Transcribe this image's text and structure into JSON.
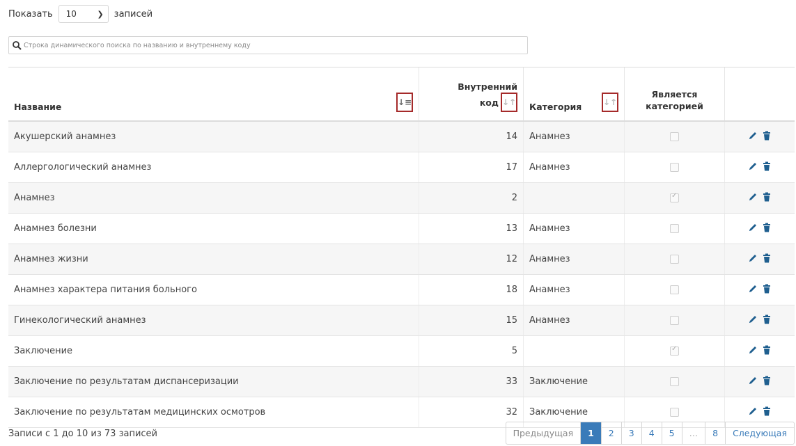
{
  "length_control": {
    "prefix": "Показать",
    "value": "10",
    "suffix": "записей"
  },
  "search": {
    "placeholder": "Строка динамического поиска по названию и внутреннему коду"
  },
  "columns": {
    "name": "Название",
    "code_line1": "Внутренний",
    "code_line2": "код",
    "category": "Категория",
    "is_category_line1": "Является",
    "is_category_line2": "категорией"
  },
  "rows": [
    {
      "name": "Акушерский анамнез",
      "code": "14",
      "category": "Анамнез",
      "is_category": false
    },
    {
      "name": "Аллергологический анамнез",
      "code": "17",
      "category": "Анамнез",
      "is_category": false
    },
    {
      "name": "Анамнез",
      "code": "2",
      "category": "",
      "is_category": true
    },
    {
      "name": "Анамнез болезни",
      "code": "13",
      "category": "Анамнез",
      "is_category": false
    },
    {
      "name": "Анамнез жизни",
      "code": "12",
      "category": "Анамнез",
      "is_category": false
    },
    {
      "name": "Анамнез характера питания больного",
      "code": "18",
      "category": "Анамнез",
      "is_category": false
    },
    {
      "name": "Гинекологический анамнез",
      "code": "15",
      "category": "Анамнез",
      "is_category": false
    },
    {
      "name": "Заключение",
      "code": "5",
      "category": "",
      "is_category": true
    },
    {
      "name": "Заключение по результатам диспансеризации",
      "code": "33",
      "category": "Заключение",
      "is_category": false
    },
    {
      "name": "Заключение по результатам медицинских осмотров",
      "code": "32",
      "category": "Заключение",
      "is_category": false
    }
  ],
  "footer": {
    "info": "Записи с 1 до 10 из 73 записей"
  },
  "pagination": {
    "prev": "Предыдущая",
    "pages": [
      "1",
      "2",
      "3",
      "4",
      "5",
      "…",
      "8"
    ],
    "current": "1",
    "next": "Следующая"
  },
  "colors": {
    "accent": "#3a7bb9",
    "highlight_border": "#a52a2a",
    "action_icon": "#1f5f8f"
  },
  "icons": {
    "search": "search-icon",
    "sort": "sort-icon",
    "edit": "pencil-icon",
    "delete": "trash-icon",
    "dropdown": "chevron-down-icon"
  }
}
